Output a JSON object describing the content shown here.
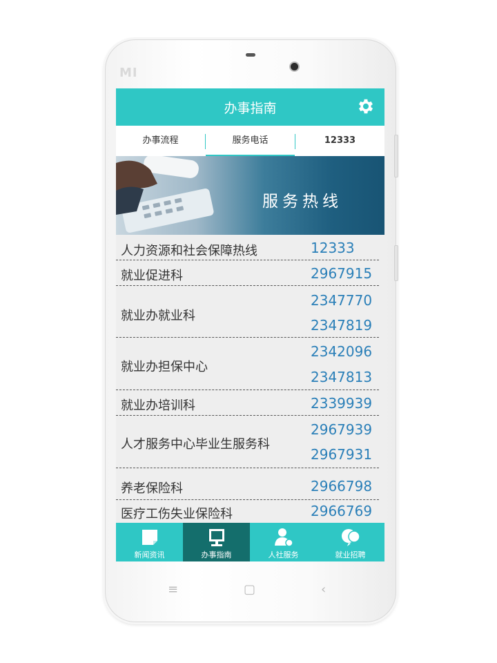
{
  "device": {
    "brand": "MI",
    "softkeys": [
      "≡",
      "▢",
      "‹"
    ]
  },
  "app": {
    "title": "办事指南",
    "accent_color": "#2fc7c5",
    "settings_icon": "gear-icon"
  },
  "tabs": [
    {
      "label": "办事流程",
      "active": false
    },
    {
      "label": "服务电话",
      "active": true
    },
    {
      "label": "12333",
      "active": false
    }
  ],
  "banner": {
    "text": "服务热线"
  },
  "contacts": [
    {
      "name": "人力资源和社会保障热线",
      "numbers": [
        "12333"
      ]
    },
    {
      "name": "就业促进科",
      "numbers": [
        "2967915"
      ]
    },
    {
      "name": "就业办就业科",
      "numbers": [
        "2347770",
        "2347819"
      ]
    },
    {
      "name": "就业办担保中心",
      "numbers": [
        "2342096",
        "2347813"
      ]
    },
    {
      "name": "就业办培训科",
      "numbers": [
        "2339939"
      ]
    },
    {
      "name": "人才服务中心毕业生服务科",
      "numbers": [
        "2967939",
        "2967931"
      ]
    },
    {
      "name": "养老保险科",
      "numbers": [
        "2966798"
      ]
    },
    {
      "name": "医疗工伤失业保险科",
      "numbers": [
        "2966769"
      ]
    }
  ],
  "bottom_nav": [
    {
      "label": "新闻资讯",
      "icon": "news-icon",
      "active": false
    },
    {
      "label": "办事指南",
      "icon": "monitor-icon",
      "active": true
    },
    {
      "label": "人社服务",
      "icon": "user-service-icon",
      "active": false
    },
    {
      "label": "就业招聘",
      "icon": "recruitment-icon",
      "active": false
    }
  ]
}
